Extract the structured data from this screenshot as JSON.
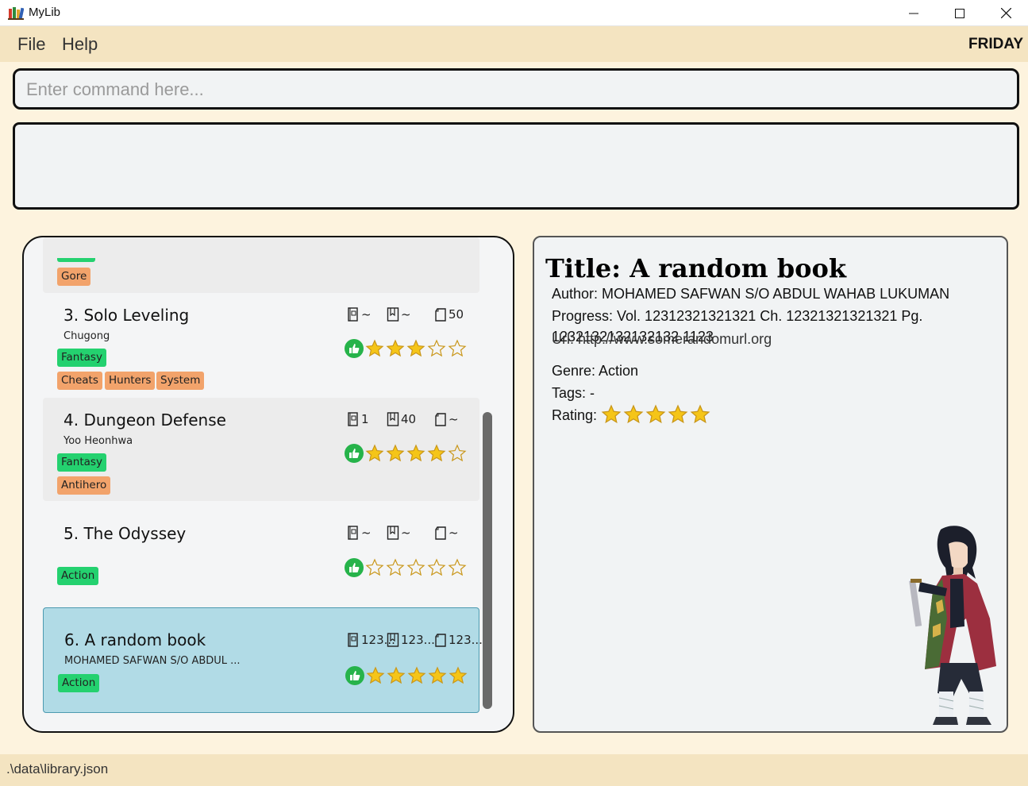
{
  "window": {
    "title": "MyLib",
    "minimize_icon": "minimize-icon",
    "maximize_icon": "maximize-icon",
    "close_icon": "close-icon"
  },
  "menu": {
    "file": "File",
    "help": "Help",
    "theme": "FRIDAY"
  },
  "command": {
    "placeholder": "Enter command here...",
    "value": ""
  },
  "result": {
    "text": ""
  },
  "list": {
    "partial_card": {
      "tags": [
        "Gore"
      ]
    },
    "books": [
      {
        "title": "3. Solo Leveling",
        "author": "Chugong",
        "genre": "Fantasy",
        "tags": [
          "Cheats",
          "Hunters",
          "System"
        ],
        "volume": "~",
        "chapter": "~",
        "page": "50",
        "rating": 3
      },
      {
        "title": "4. Dungeon Defense",
        "author": "Yoo Heonhwa",
        "genre": "Fantasy",
        "tags": [
          "Antihero"
        ],
        "volume": "1",
        "chapter": "40",
        "page": "~",
        "rating": 4
      },
      {
        "title": "5. The Odyssey",
        "author": "",
        "genre": "Action",
        "tags": [],
        "volume": "~",
        "chapter": "~",
        "page": "~",
        "rating": 0
      },
      {
        "title": "6. A random book",
        "author": "MOHAMED SAFWAN S/O ABDUL ...",
        "genre": "Action",
        "tags": [],
        "volume": "123...",
        "chapter": "123...",
        "page": "123...",
        "rating": 5
      }
    ]
  },
  "detail": {
    "title": "Title: A random book",
    "author": "Author: MOHAMED SAFWAN S/O ABDUL WAHAB LUKUMAN",
    "progress": "Progress: Vol. 12312321321321 Ch. 12321321321321 Pg. 1232132132132132 1123",
    "url": "Url: http://www.somerandomurl.org",
    "genre": "Genre: Action",
    "tags": "Tags: -",
    "rating_label": "Rating:",
    "rating": 5
  },
  "status": {
    "path": ".\\data\\library.json"
  },
  "colors": {
    "background": "#fdf3de",
    "menubar": "#f4e4c1",
    "genre_tag": "#24d16f",
    "other_tag": "#f2a36b",
    "selected_card": "#b1dbe6",
    "star_fill": "#f5c518",
    "thumb": "#26b34a"
  }
}
